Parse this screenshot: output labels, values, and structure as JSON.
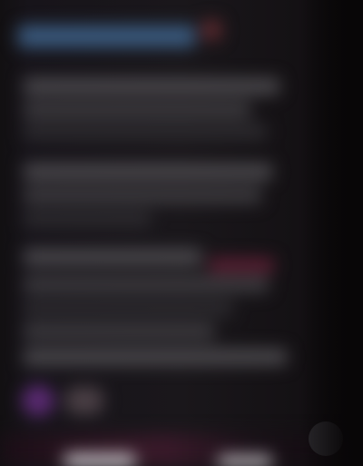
{
  "screen": {
    "content_state": "blurred",
    "accent_colors": {
      "header": "#3a5a7e",
      "badge": "#5c2a2f",
      "highlight": "#5a1f33",
      "avatar": "#5a2a72"
    }
  },
  "icons": {
    "corner_button": "chat-bubble-icon"
  }
}
